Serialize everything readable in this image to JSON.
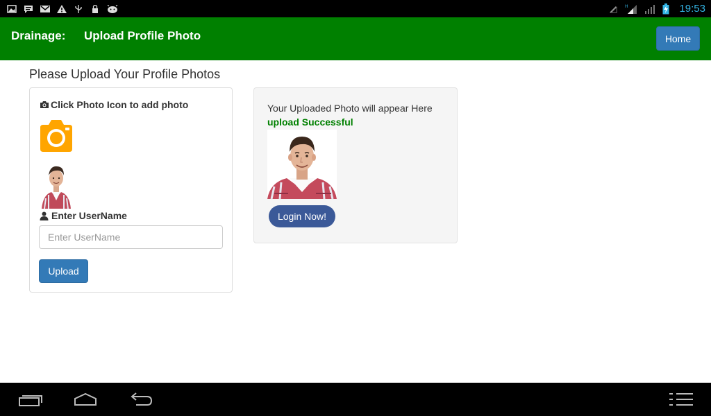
{
  "status_bar": {
    "left_icons": [
      "picture-icon",
      "message-icon",
      "mail-icon",
      "warning-icon",
      "usb-icon",
      "lock-icon",
      "android-icon"
    ],
    "right_icons": [
      "no-signal-icon",
      "hspa-signal-icon",
      "signal-bars-icon",
      "battery-charging-icon"
    ],
    "time": "19:53",
    "time_color": "#33b5e5"
  },
  "header": {
    "brand": "Drainage:",
    "title": "Upload Profile Photo",
    "home_label": "Home",
    "background": "#008000"
  },
  "main": {
    "heading": "Please Upload Your Profile Photos"
  },
  "upload_panel": {
    "click_label": "Click Photo Icon to add photo",
    "camera_icon": "camera-icon",
    "username_label": "Enter UserName",
    "username_placeholder": "Enter UserName",
    "username_value": "",
    "upload_label": "Upload"
  },
  "preview_panel": {
    "appear_text": "Your Uploaded Photo will appear Here",
    "success_text": "upload Successful",
    "login_label": "Login Now!"
  },
  "nav_bar": {
    "icons": [
      "recent-apps-icon",
      "home-icon",
      "back-icon",
      "menu-icon"
    ]
  }
}
